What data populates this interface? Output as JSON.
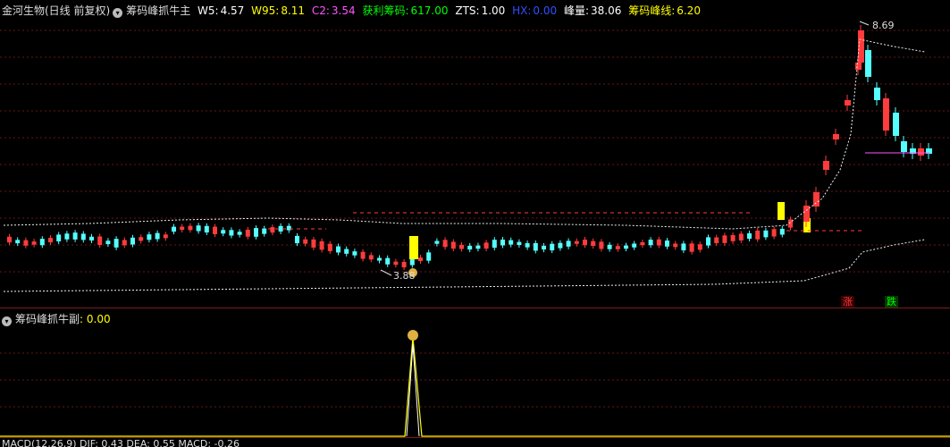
{
  "main": {
    "stock_name": "金河生物(日线 前复权)",
    "indicator": "筹码峰抓牛主",
    "w5_label": "W5:",
    "w5_value": "4.57",
    "w95_label": "W95:",
    "w95_value": "8.11",
    "c2_label": "C2:",
    "c2_value": "3.54",
    "profit_label": "获利筹码:",
    "profit_value": "617.00",
    "zts_label": "ZTS:",
    "zts_value": "1.00",
    "hx_label": "HX:",
    "hx_value": "0.00",
    "peak_label": "峰量:",
    "peak_value": "38.06",
    "peakline_label": "筹码峰线:",
    "peakline_value": "6.20",
    "high_price": "8.69",
    "low_price": "3.88",
    "tag_up": "涨",
    "tag_down": "跌"
  },
  "sub": {
    "indicator": "筹码峰抓牛副",
    "value": ": 0.00"
  },
  "macd": {
    "text": "MACD(12,26,9) DIF: 0.43 DEA: 0.55 MACD: -0.26"
  },
  "colors": {
    "up": "#ff3c3c",
    "down": "#54ffff",
    "yellow": "#ffff00",
    "grid": "#7a1c1c",
    "white": "#ffffff",
    "magenta": "#ff54ff",
    "green": "#00ff00",
    "blue": "#3050ff"
  }
}
